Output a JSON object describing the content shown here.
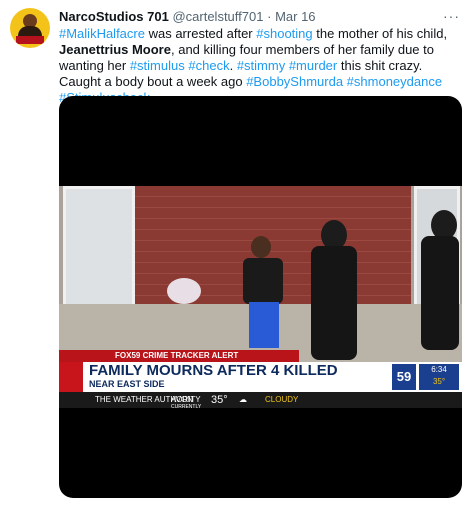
{
  "tweet": {
    "display_name": "NarcoStudios 701",
    "handle": "@cartelstuff701",
    "separator": "·",
    "date": "Mar 16",
    "more": "···",
    "text_parts": [
      {
        "text": "#MalikHalfacre",
        "style": "link"
      },
      {
        "text": " was arrested after ",
        "style": "plain"
      },
      {
        "text": "#shooting",
        "style": "link"
      },
      {
        "text": " the mother of his child, ",
        "style": "plain"
      },
      {
        "text": "Jeanettrius Moore",
        "style": "bold"
      },
      {
        "text": ", and killing four members of her family due to wanting her ",
        "style": "plain"
      },
      {
        "text": "#stimulus",
        "style": "link"
      },
      {
        "text": " ",
        "style": "plain"
      },
      {
        "text": "#check",
        "style": "link"
      },
      {
        "text": ". ",
        "style": "plain"
      },
      {
        "text": "#stimmy",
        "style": "link"
      },
      {
        "text": " ",
        "style": "plain"
      },
      {
        "text": "#murder",
        "style": "link"
      },
      {
        "text": " this shit crazy. Caught a body bout a week ago ",
        "style": "plain"
      },
      {
        "text": "#BobbyShmurda",
        "style": "link"
      },
      {
        "text": " ",
        "style": "plain"
      },
      {
        "text": "#shmoneydance",
        "style": "link"
      },
      {
        "text": " ",
        "style": "plain"
      },
      {
        "text": "#Stimuluscheck",
        "style": "link"
      }
    ]
  },
  "video": {
    "alert_bar": "FOX59 CRIME TRACKER ALERT",
    "headline": "FAMILY MOURNS AFTER 4 KILLED",
    "subline": "NEAR EAST SIDE",
    "station_logo": "59",
    "time": "6:34",
    "temp_corner": "35°",
    "ticker_brand": "THE WEATHER AUTHORITY",
    "ticker_city": "AVON",
    "ticker_label": "CURRENTLY",
    "ticker_temp": "35°",
    "ticker_condition": "CLOUDY"
  },
  "colors": {
    "link": "#1d9bf0",
    "text": "#0f1419",
    "muted": "#536471",
    "news_red": "#b8141a",
    "news_blue": "#1b3f8f"
  }
}
